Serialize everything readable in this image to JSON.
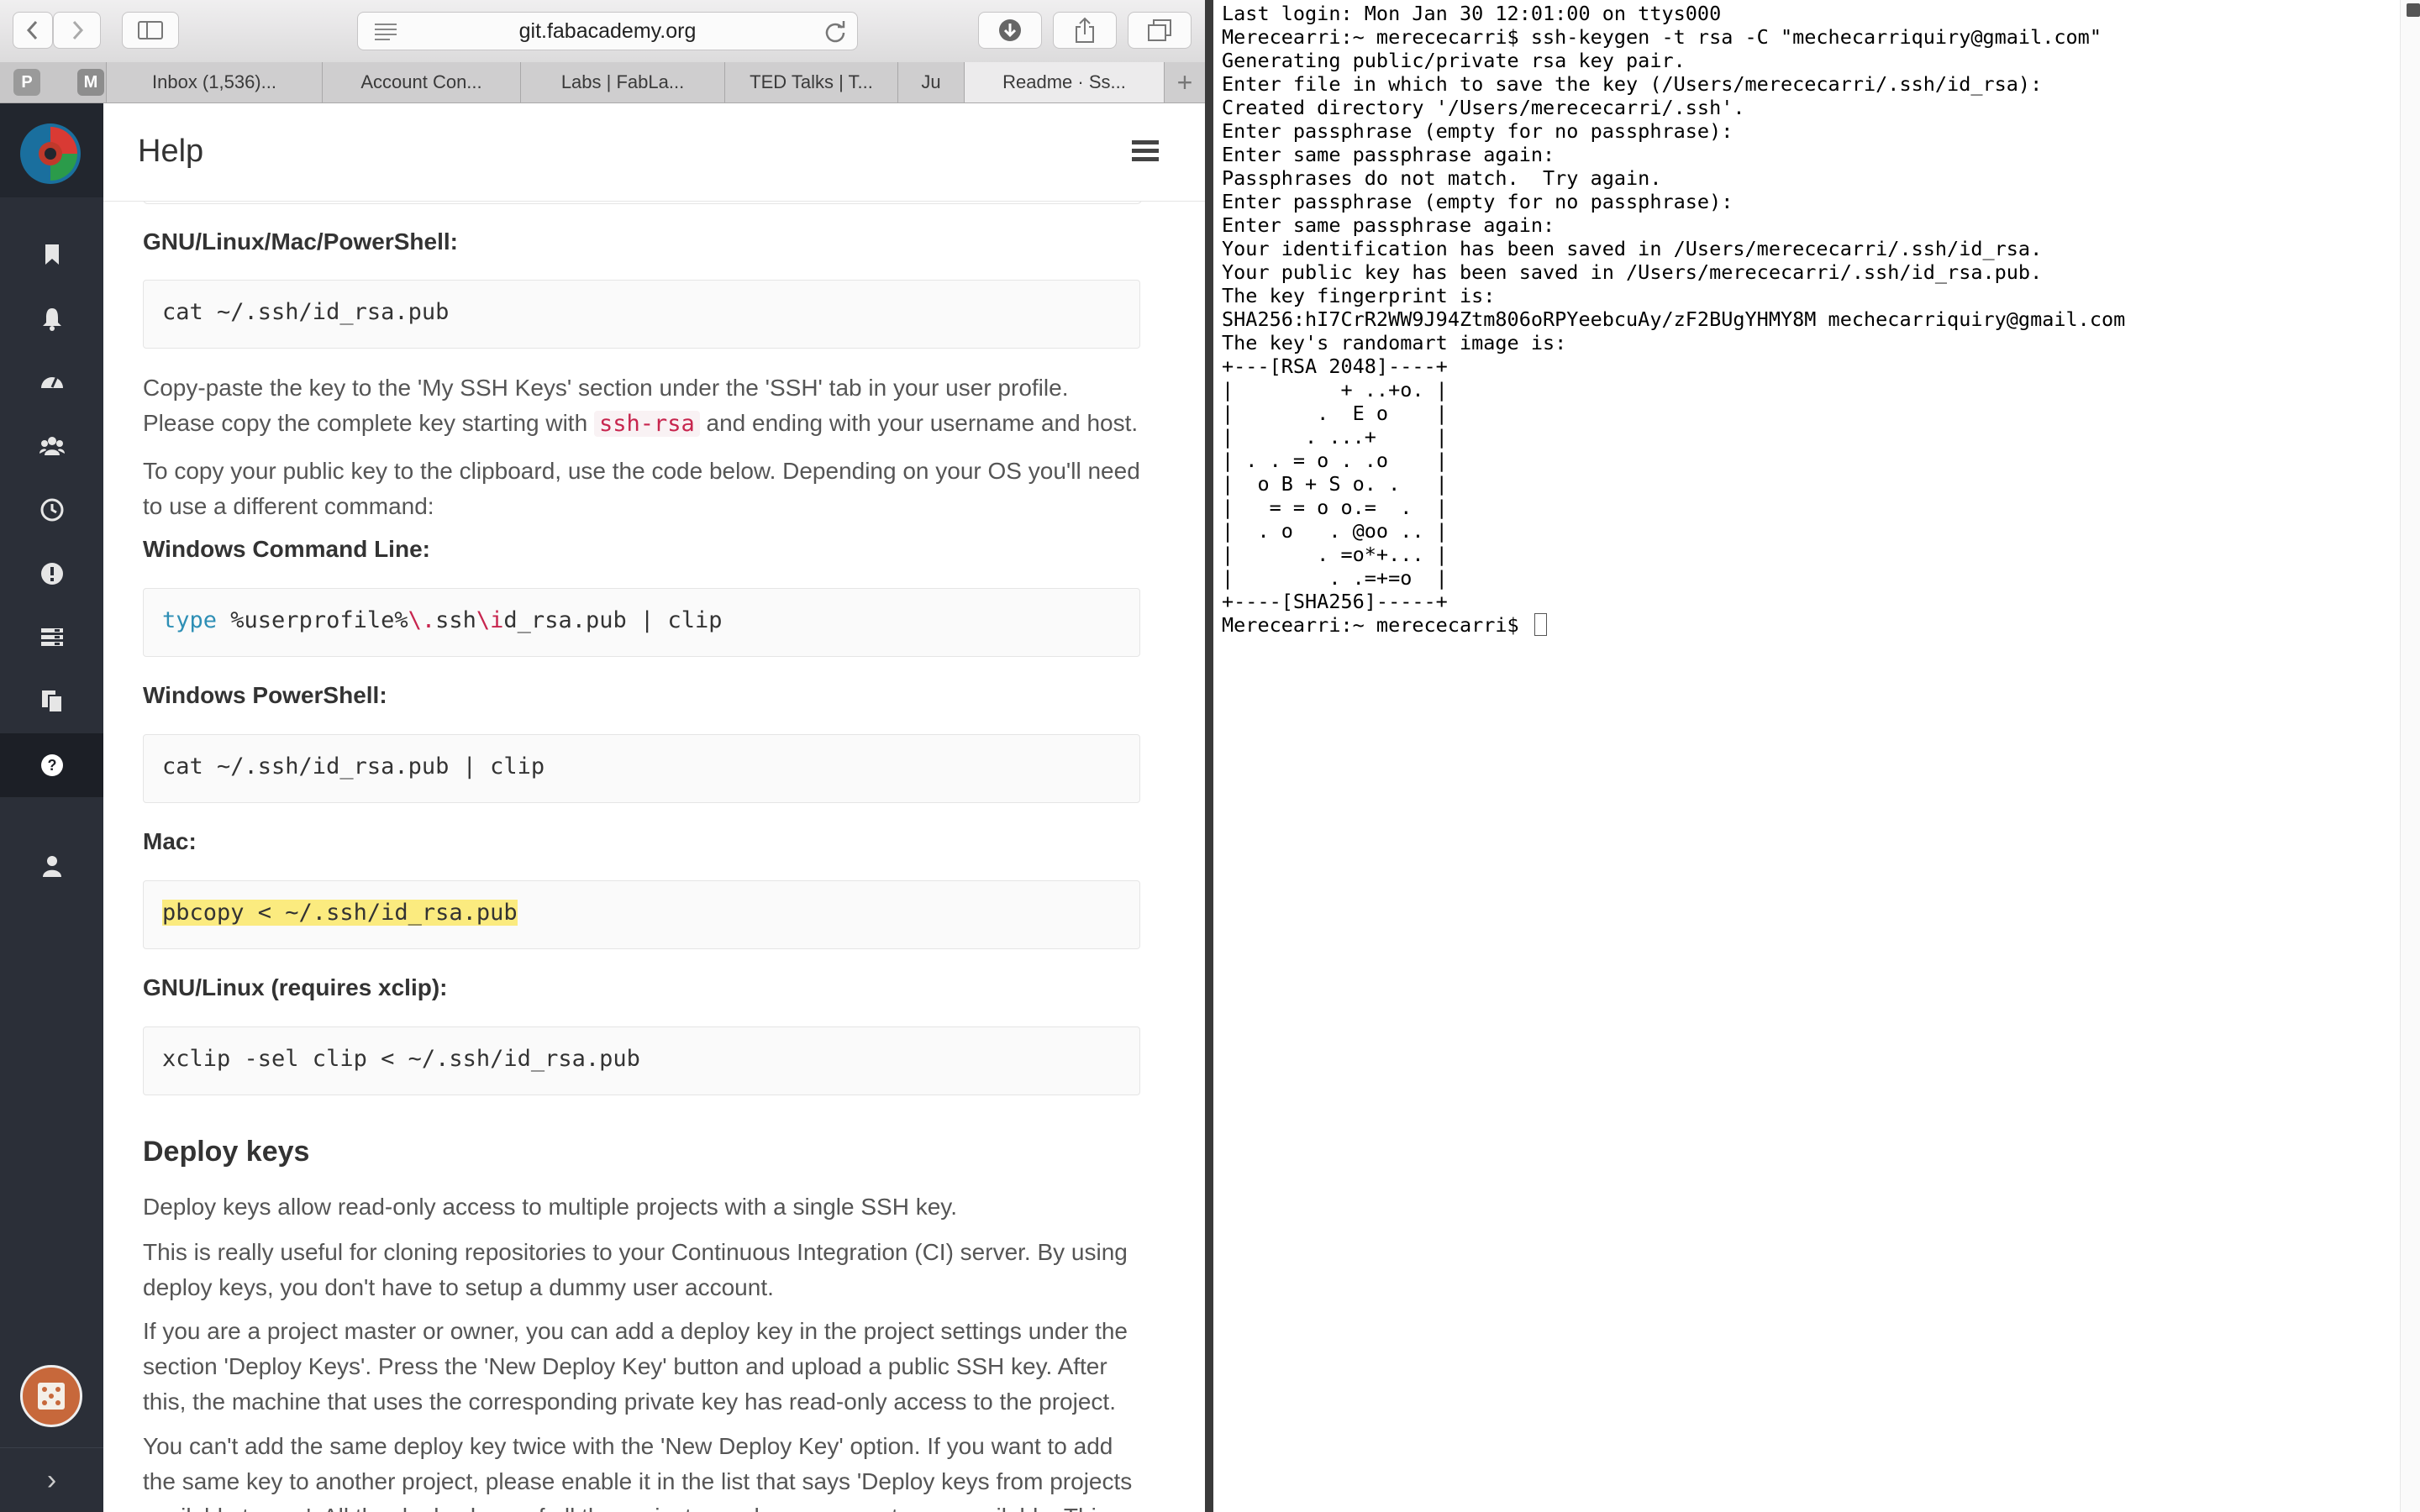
{
  "browser": {
    "url": "git.fabacademy.org",
    "tabs": [
      {
        "label": "Inbox (1,536)..."
      },
      {
        "label": "Account Con..."
      },
      {
        "label": "Labs | FabLa..."
      },
      {
        "label": "TED Talks | T..."
      },
      {
        "label": "Ju"
      },
      {
        "label": "Readme · Ss..."
      }
    ],
    "pinned": [
      "pinterest-icon",
      "gmail-icon"
    ],
    "new_tab_label": "+"
  },
  "gitlab": {
    "header_title": "Help",
    "sidebar_items": [
      "bookmark-icon",
      "bell-icon",
      "dashboard-icon",
      "groups-icon",
      "clock-icon",
      "alert-icon",
      "snippets-icon",
      "copy-icon",
      "help-icon",
      "user-icon"
    ],
    "expand_label": "›"
  },
  "doc": {
    "h_gnu_mac": "GNU/Linux/Mac/PowerShell:",
    "code_cat": "cat ~/.ssh/id_rsa.pub",
    "p_copy_paste_1": "Copy-paste the key to the 'My SSH Keys' section under the 'SSH' tab in your user profile. Please copy the complete key starting with ",
    "p_copy_paste_code": "ssh-rsa",
    "p_copy_paste_2": " and ending with your username and host.",
    "p_clipboard": "To copy your public key to the clipboard, use the code below. Depending on your OS you'll need to use a different command:",
    "h_windows_cmd": "Windows Command Line:",
    "code_windows_cmd_kw": "type",
    "code_windows_cmd_a": " %userprofile%",
    "code_windows_cmd_b": "\\.",
    "code_windows_cmd_c": "ssh",
    "code_windows_cmd_d": "\\i",
    "code_windows_cmd_e": "d_rsa.pub | clip",
    "h_windows_ps": "Windows PowerShell:",
    "code_windows_ps": "cat ~/.ssh/id_rsa.pub | clip",
    "h_mac": "Mac:",
    "code_mac": "pbcopy < ~/.ssh/id_rsa.pub",
    "h_gnu_xclip": "GNU/Linux (requires xclip):",
    "code_xclip": "xclip -sel clip < ~/.ssh/id_rsa.pub",
    "h_deploy": "Deploy keys",
    "p_deploy_1": "Deploy keys allow read-only access to multiple projects with a single SSH key.",
    "p_deploy_2": "This is really useful for cloning repositories to your Continuous Integration (CI) server. By using deploy keys, you don't have to setup a dummy user account.",
    "p_deploy_3": "If you are a project master or owner, you can add a deploy key in the project settings under the section 'Deploy Keys'. Press the 'New Deploy Key' button and upload a public SSH key. After this, the machine that uses the corresponding private key has read-only access to the project.",
    "p_deploy_4": "You can't add the same deploy key twice with the 'New Deploy Key' option. If you want to add the same key to another project, please enable it in the list that says 'Deploy keys from projects available to you'. All the deploy keys of all the projects you have access to are available. This"
  },
  "terminal": {
    "lines": "Last login: Mon Jan 30 12:01:00 on ttys000\nMerecearri:~ merececarri$ ssh-keygen -t rsa -C \"mechecarriquiry@gmail.com\"\nGenerating public/private rsa key pair.\nEnter file in which to save the key (/Users/merececarri/.ssh/id_rsa):\nCreated directory '/Users/merececarri/.ssh'.\nEnter passphrase (empty for no passphrase):\nEnter same passphrase again:\nPassphrases do not match.  Try again.\nEnter passphrase (empty for no passphrase):\nEnter same passphrase again:\nYour identification has been saved in /Users/merececarri/.ssh/id_rsa.\nYour public key has been saved in /Users/merececarri/.ssh/id_rsa.pub.\nThe key fingerprint is:\nSHA256:hI7CrR2WW9J94Ztm806oRPYeebcuAy/zF2BUgYHMY8M mechecarriquiry@gmail.com\nThe key's randomart image is:\n+---[RSA 2048]----+\n|         + ..+o. |\n|       .  E o    |\n|      . ...+     |\n| . . = o . .o    |\n|  o B + S o. .   |\n|   = = o o.=  .  |\n|  . o   . @oo .. |\n|       . =o*+... |\n|        . .=+=o  |\n+----[SHA256]-----+\nMerecearri:~ merececarri$ "
  }
}
